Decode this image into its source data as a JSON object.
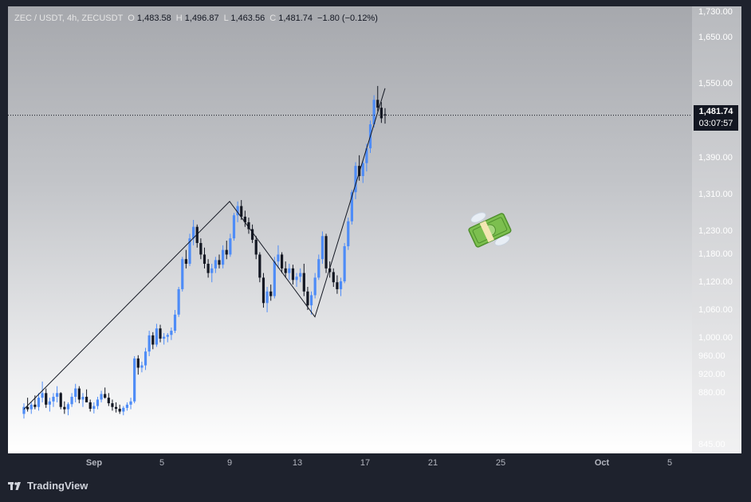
{
  "legend": {
    "symbol": "ZEC / USDT, 4h, ZECUSDT",
    "open_label": "O",
    "open": "1,483.58",
    "high_label": "H",
    "high": "1,496.87",
    "low_label": "L",
    "low": "1,463.56",
    "close_label": "C",
    "close": "1,481.74",
    "change": "−1.80 (−0.12%)"
  },
  "price_axis": {
    "ticks": [
      "1,730.00",
      "1,650.00",
      "1,550.00",
      "1,390.00",
      "1,310.00",
      "1,230.00",
      "1,180.00",
      "1,120.00",
      "1,060.00",
      "1,000.00",
      "960.00",
      "920.00",
      "880.00",
      "845.00"
    ],
    "last_price": "1,481.74",
    "countdown": "03:07:57"
  },
  "time_axis": {
    "ticks": [
      "Sep",
      "5",
      "9",
      "13",
      "17",
      "21",
      "25",
      "Oct",
      "5"
    ]
  },
  "footer": {
    "brand": "TradingView"
  },
  "icons": {
    "brand_logo": "tradingview-logo-icon",
    "sticker": "money-with-wings-icon"
  },
  "colors": {
    "up": "#4e8cf7",
    "down": "#131722",
    "background_top": "#a6a8ad",
    "background_bottom": "#ffffff"
  },
  "chart_data": {
    "type": "candlestick",
    "symbol": "ZECUSDT",
    "interval": "4h",
    "x_labels": [
      "Sep",
      "5",
      "9",
      "13",
      "17",
      "21",
      "25",
      "Oct",
      "5"
    ],
    "price_range": [
      840,
      1730
    ],
    "last": 1481.74,
    "zigzag_pivots": [
      {
        "time": "Aug 31",
        "price": 845
      },
      {
        "time": "Sep 9",
        "price": 1295
      },
      {
        "time": "Sep 14",
        "price": 1045
      },
      {
        "time": "Sep 18",
        "price": 1540
      }
    ],
    "candles": [
      [
        835,
        858,
        825,
        850
      ],
      [
        850,
        870,
        840,
        845
      ],
      [
        845,
        860,
        835,
        855
      ],
      [
        855,
        875,
        845,
        850
      ],
      [
        850,
        880,
        842,
        870
      ],
      [
        870,
        905,
        860,
        880
      ],
      [
        880,
        890,
        848,
        855
      ],
      [
        855,
        870,
        840,
        862
      ],
      [
        862,
        880,
        850,
        872
      ],
      [
        872,
        895,
        860,
        880
      ],
      [
        880,
        882,
        845,
        850
      ],
      [
        850,
        862,
        835,
        845
      ],
      [
        845,
        860,
        832,
        856
      ],
      [
        856,
        880,
        850,
        872
      ],
      [
        872,
        900,
        860,
        890
      ],
      [
        890,
        895,
        858,
        866
      ],
      [
        866,
        880,
        850,
        872
      ],
      [
        872,
        888,
        860,
        860
      ],
      [
        860,
        866,
        840,
        846
      ],
      [
        846,
        860,
        836,
        852
      ],
      [
        852,
        872,
        845,
        866
      ],
      [
        866,
        885,
        860,
        878
      ],
      [
        878,
        892,
        868,
        870
      ],
      [
        870,
        880,
        852,
        858
      ],
      [
        858,
        866,
        842,
        850
      ],
      [
        850,
        860,
        838,
        846
      ],
      [
        846,
        855,
        835,
        840
      ],
      [
        840,
        852,
        832,
        848
      ],
      [
        848,
        860,
        842,
        855
      ],
      [
        855,
        870,
        845,
        862
      ],
      [
        862,
        960,
        858,
        955
      ],
      [
        955,
        962,
        920,
        935
      ],
      [
        935,
        948,
        925,
        940
      ],
      [
        940,
        978,
        930,
        970
      ],
      [
        970,
        1015,
        960,
        1005
      ],
      [
        1005,
        1012,
        975,
        985
      ],
      [
        985,
        1030,
        980,
        1020
      ],
      [
        1020,
        1028,
        990,
        998
      ],
      [
        998,
        1010,
        985,
        1002
      ],
      [
        1002,
        1010,
        990,
        1006
      ],
      [
        1006,
        1022,
        995,
        1015
      ],
      [
        1015,
        1060,
        1010,
        1050
      ],
      [
        1050,
        1110,
        1045,
        1105
      ],
      [
        1105,
        1175,
        1100,
        1170
      ],
      [
        1170,
        1190,
        1150,
        1160
      ],
      [
        1160,
        1225,
        1155,
        1215
      ],
      [
        1215,
        1255,
        1200,
        1240
      ],
      [
        1240,
        1245,
        1195,
        1205
      ],
      [
        1205,
        1215,
        1170,
        1180
      ],
      [
        1180,
        1195,
        1150,
        1160
      ],
      [
        1160,
        1170,
        1130,
        1140
      ],
      [
        1140,
        1160,
        1120,
        1150
      ],
      [
        1150,
        1175,
        1140,
        1168
      ],
      [
        1168,
        1180,
        1150,
        1158
      ],
      [
        1158,
        1200,
        1150,
        1190
      ],
      [
        1190,
        1210,
        1170,
        1180
      ],
      [
        1180,
        1225,
        1175,
        1215
      ],
      [
        1215,
        1270,
        1210,
        1265
      ],
      [
        1265,
        1295,
        1250,
        1285
      ],
      [
        1285,
        1298,
        1255,
        1262
      ],
      [
        1262,
        1275,
        1240,
        1250
      ],
      [
        1250,
        1260,
        1225,
        1235
      ],
      [
        1235,
        1245,
        1205,
        1212
      ],
      [
        1212,
        1220,
        1170,
        1180
      ],
      [
        1180,
        1185,
        1120,
        1130
      ],
      [
        1130,
        1140,
        1065,
        1075
      ],
      [
        1075,
        1110,
        1055,
        1100
      ],
      [
        1100,
        1115,
        1080,
        1090
      ],
      [
        1090,
        1175,
        1085,
        1165
      ],
      [
        1165,
        1200,
        1150,
        1180
      ],
      [
        1180,
        1185,
        1140,
        1150
      ],
      [
        1150,
        1165,
        1130,
        1140
      ],
      [
        1140,
        1160,
        1125,
        1150
      ],
      [
        1150,
        1158,
        1115,
        1125
      ],
      [
        1125,
        1140,
        1110,
        1132
      ],
      [
        1132,
        1150,
        1120,
        1140
      ],
      [
        1140,
        1160,
        1090,
        1100
      ],
      [
        1100,
        1110,
        1060,
        1070
      ],
      [
        1070,
        1100,
        1050,
        1092
      ],
      [
        1092,
        1140,
        1085,
        1130
      ],
      [
        1130,
        1180,
        1125,
        1170
      ],
      [
        1170,
        1230,
        1160,
        1220
      ],
      [
        1220,
        1225,
        1140,
        1150
      ],
      [
        1150,
        1165,
        1130,
        1142
      ],
      [
        1142,
        1150,
        1110,
        1120
      ],
      [
        1120,
        1135,
        1095,
        1105
      ],
      [
        1105,
        1130,
        1090,
        1122
      ],
      [
        1122,
        1205,
        1118,
        1198
      ],
      [
        1198,
        1260,
        1190,
        1252
      ],
      [
        1252,
        1320,
        1245,
        1315
      ],
      [
        1315,
        1380,
        1300,
        1372
      ],
      [
        1372,
        1395,
        1340,
        1350
      ],
      [
        1350,
        1385,
        1335,
        1378
      ],
      [
        1378,
        1420,
        1360,
        1410
      ],
      [
        1410,
        1470,
        1400,
        1462
      ],
      [
        1462,
        1525,
        1455,
        1515
      ],
      [
        1515,
        1545,
        1490,
        1498
      ],
      [
        1498,
        1510,
        1465,
        1475
      ],
      [
        1483.58,
        1496.87,
        1463.56,
        1481.74
      ]
    ]
  }
}
